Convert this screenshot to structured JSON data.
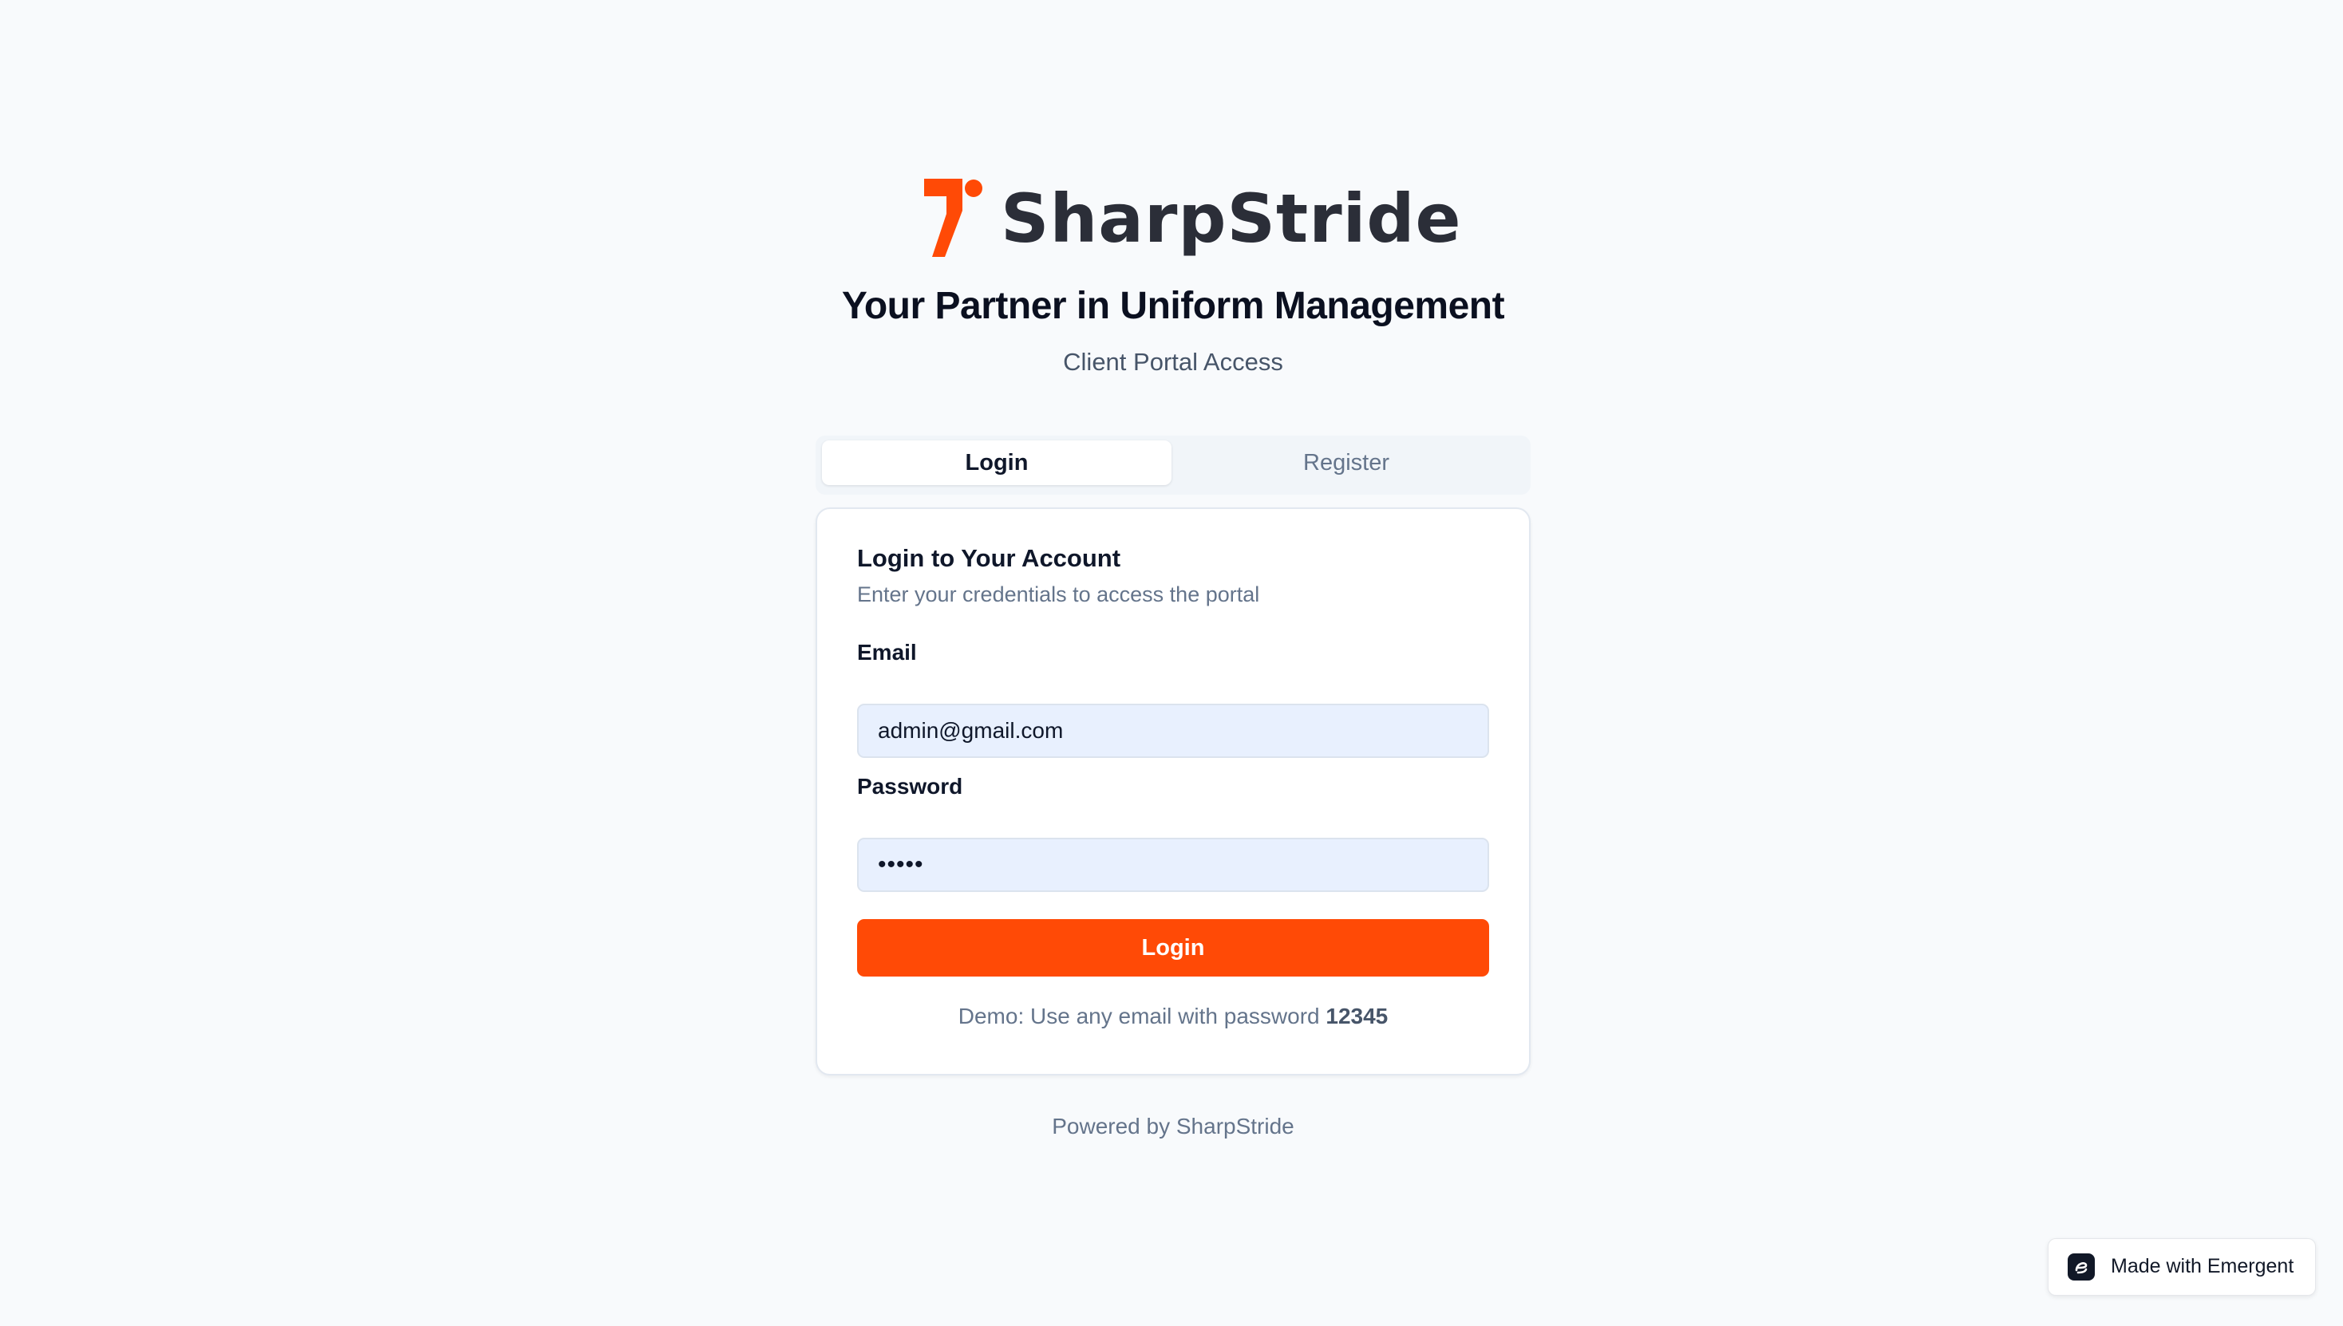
{
  "brand": {
    "name": "SharpStride",
    "accent_color": "#ff4a06",
    "logo_icon": "sharpstride-logo-icon"
  },
  "header": {
    "headline": "Your Partner in Uniform Management",
    "subheadline": "Client Portal Access"
  },
  "tabs": [
    {
      "label": "Login",
      "active": true
    },
    {
      "label": "Register",
      "active": false
    }
  ],
  "login_card": {
    "title": "Login to Your Account",
    "description": "Enter your credentials to access the portal",
    "email_label": "Email",
    "email_value": "admin@gmail.com",
    "password_label": "Password",
    "password_value": "•••••",
    "submit_label": "Login",
    "demo_prefix": "Demo: Use any email with password",
    "demo_password": "12345"
  },
  "footer": {
    "powered_by": "Powered by SharpStride"
  },
  "badge": {
    "label": "Made with Emergent",
    "icon": "emergent-logo-icon"
  }
}
